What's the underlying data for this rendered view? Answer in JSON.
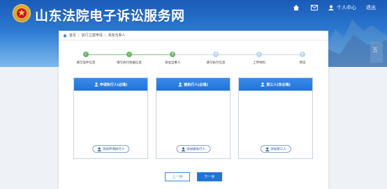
{
  "header": {
    "site_title": "山东法院电子诉讼服务网",
    "user_center": "个人中心",
    "logout": "退出"
  },
  "breadcrumb": [
    "首页",
    "执行立案申请",
    "添加当事人"
  ],
  "steps": [
    {
      "label": "填写案件信息",
      "status": "done"
    },
    {
      "label": "填写执行依据信息",
      "status": "done"
    },
    {
      "label": "添加当事人",
      "status": "current"
    },
    {
      "label": "填写执行信息",
      "status": "todo"
    },
    {
      "label": "上传材料",
      "status": "todo"
    },
    {
      "label": "预览",
      "status": "todo"
    }
  ],
  "panels": [
    {
      "title": "申请执行人(必填)",
      "button": "添加申请执行人"
    },
    {
      "title": "被执行人(必填)",
      "button": "添加被执行人"
    },
    {
      "title": "第三人(非必填)",
      "button": "添加第三人"
    }
  ],
  "buttons": {
    "prev": "上一步",
    "next": "下一步"
  },
  "colors": {
    "header_blue": "#1f73d9",
    "step_done": "#69b869",
    "step_todo": "#b9d8f4"
  }
}
